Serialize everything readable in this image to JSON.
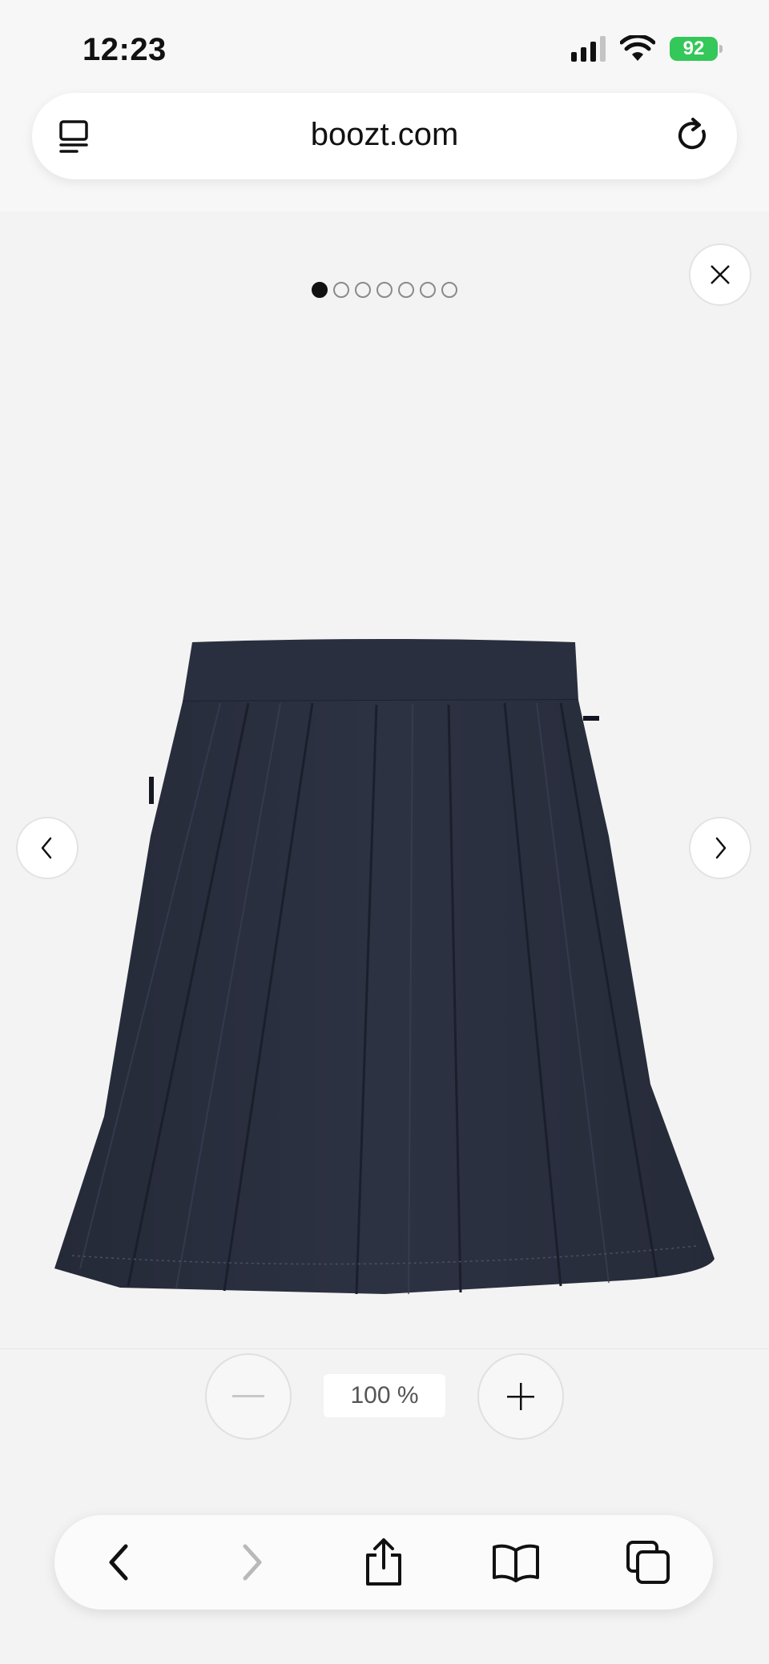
{
  "status_bar": {
    "time": "12:23",
    "battery": "92",
    "icons": [
      "signal-icon",
      "wifi-icon",
      "battery-icon"
    ]
  },
  "address_bar": {
    "domain": "boozt.com",
    "icons": [
      "tab-overview-icon",
      "reload-icon"
    ]
  },
  "gallery": {
    "image_count": 7,
    "active_index": 0,
    "product": "navy pleated skirt photo",
    "icons": [
      "close-icon",
      "chevron-left-icon",
      "chevron-right-icon"
    ],
    "colors": {
      "skirt": "#2b3040",
      "background": "#f3f3f3"
    }
  },
  "zoom": {
    "level": "100 %",
    "icons": [
      "minus-icon",
      "plus-icon"
    ]
  },
  "toolbar": {
    "icons": [
      "back-icon",
      "forward-icon",
      "share-icon",
      "bookmarks-icon",
      "tabs-icon"
    ]
  }
}
